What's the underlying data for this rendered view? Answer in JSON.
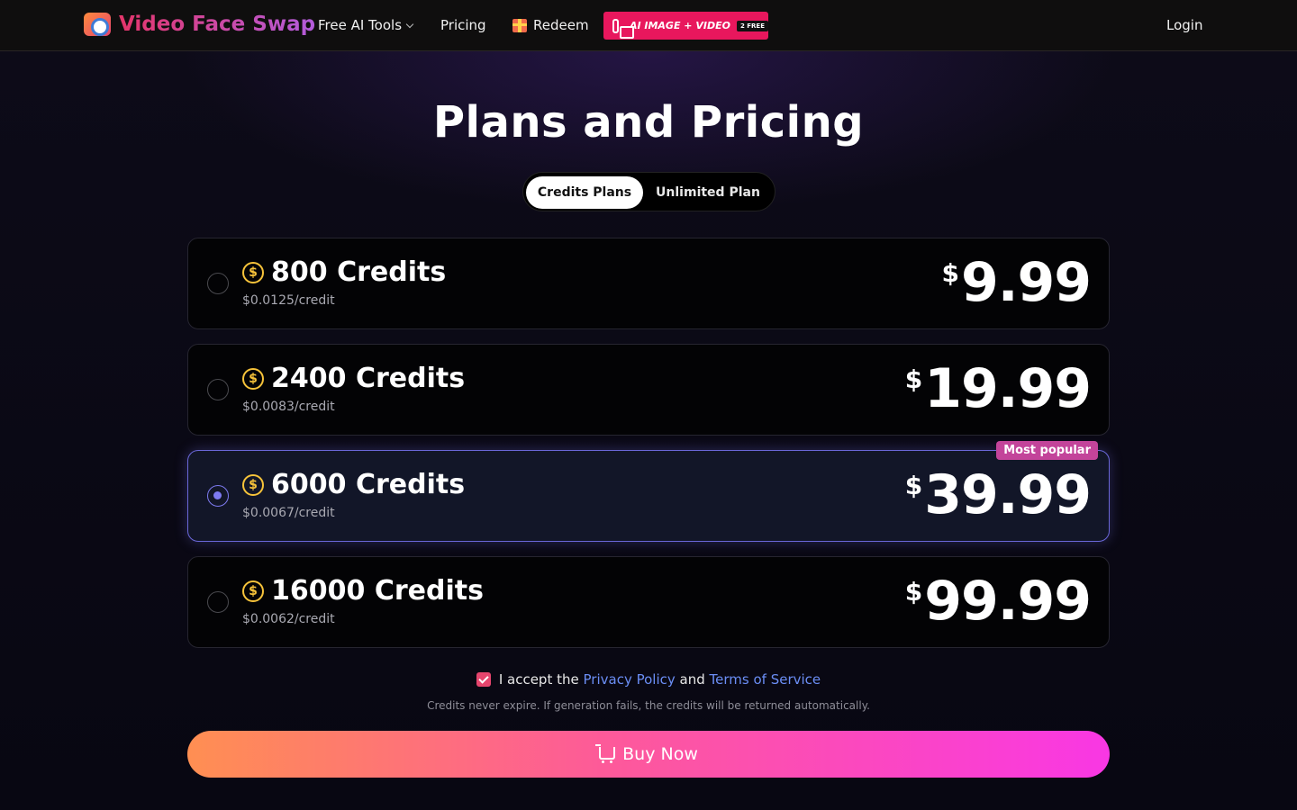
{
  "nav": {
    "brand": "Video Face Swap",
    "free_tools": "Free AI Tools",
    "pricing": "Pricing",
    "redeem": "Redeem",
    "promo_text": "AI IMAGE + VIDEO",
    "promo_badge": "2 FREE",
    "login": "Login"
  },
  "page": {
    "title": "Plans and Pricing"
  },
  "toggle": {
    "credits_plans": "Credits Plans",
    "unlimited_plan": "Unlimited Plan",
    "active": "Credits Plans"
  },
  "plans": [
    {
      "name": "800 Credits",
      "rate": "$0.0125/credit",
      "currency": "$",
      "price": "9.99",
      "selected": false
    },
    {
      "name": "2400 Credits",
      "rate": "$0.0083/credit",
      "currency": "$",
      "price": "19.99",
      "selected": false
    },
    {
      "name": "6000 Credits",
      "rate": "$0.0067/credit",
      "currency": "$",
      "price": "39.99",
      "selected": true,
      "badge": "Most popular"
    },
    {
      "name": "16000 Credits",
      "rate": "$0.0062/credit",
      "currency": "$",
      "price": "99.99",
      "selected": false
    }
  ],
  "coin_symbol": "$",
  "agreement": {
    "prefix": "I accept the",
    "privacy": "Privacy Policy",
    "and": "and",
    "terms": "Terms of Service",
    "checked": true
  },
  "note": "Credits never expire. If generation fails, the credits will be returned automatically.",
  "buy_label": "Buy Now",
  "colors": {
    "accent_purple": "#7d7af0",
    "brand_pink": "#e8175d",
    "coin_gold": "#f7c33a",
    "link_blue": "#6b8ef5"
  }
}
